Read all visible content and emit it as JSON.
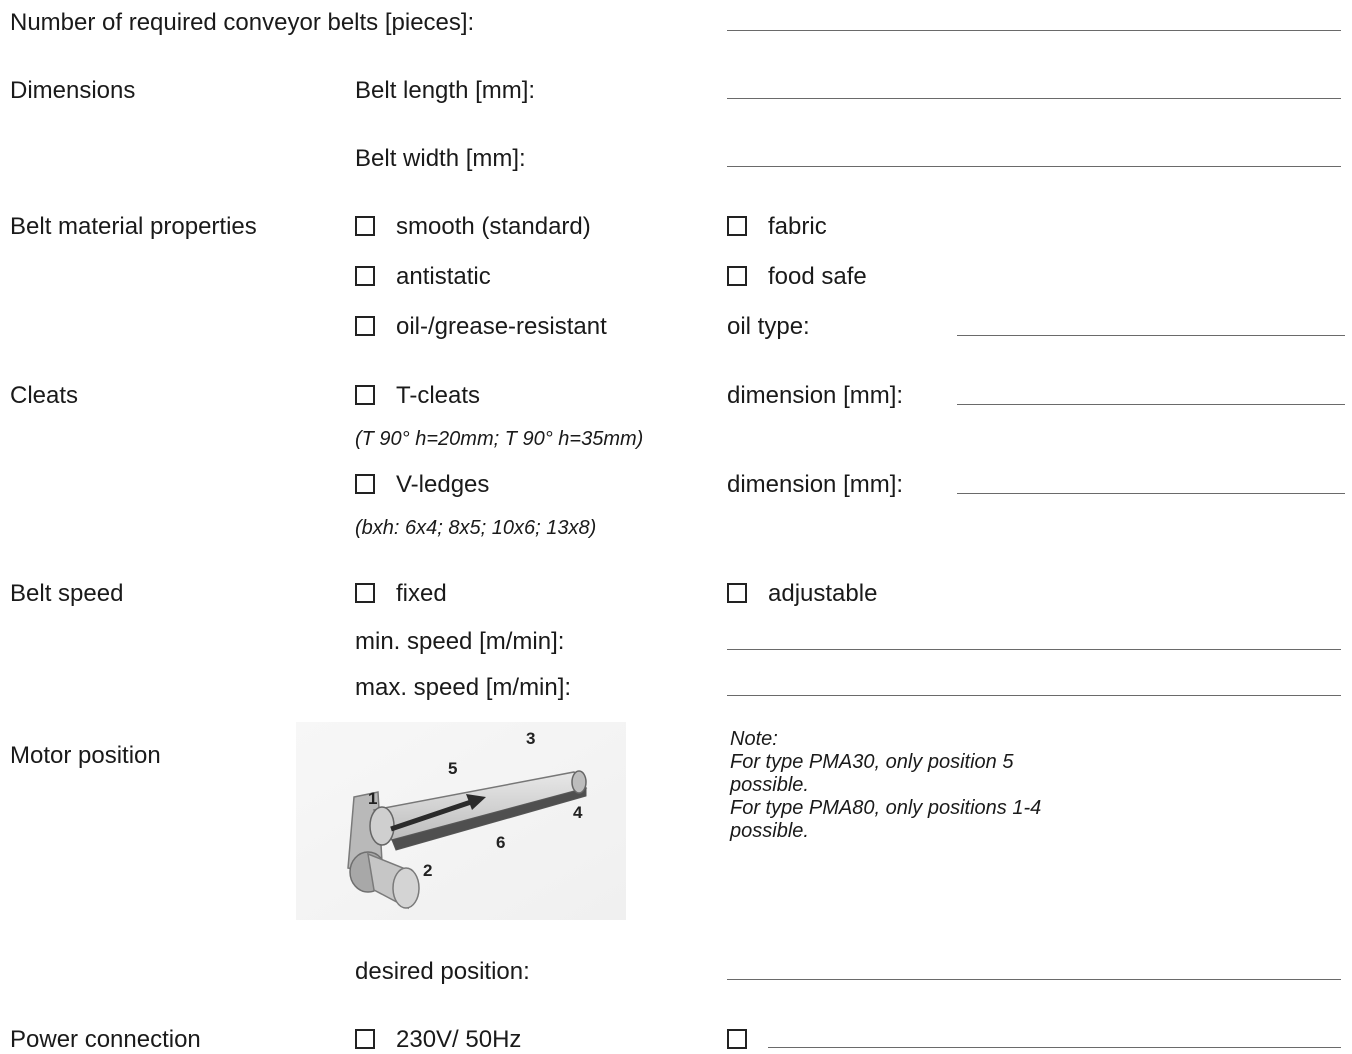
{
  "rows": {
    "count_label": "Number of required conveyor belts [pieces]:",
    "dimensions": {
      "label": "Dimensions",
      "length": "Belt length [mm]:",
      "width": "Belt width [mm]:"
    },
    "material": {
      "label": "Belt material properties",
      "opt_smooth": "smooth (standard)",
      "opt_fabric": "fabric",
      "opt_antistatic": "antistatic",
      "opt_food": "food safe",
      "opt_oil": "oil-/grease-resistant",
      "oil_type": "oil type:"
    },
    "cleats": {
      "label": "Cleats",
      "opt_t": "T-cleats",
      "t_note": "(T 90° h=20mm; T 90° h=35mm)",
      "dim1": "dimension [mm]:",
      "opt_v": "V-ledges",
      "v_note": "(bxh: 6x4; 8x5; 10x6; 13x8)",
      "dim2": "dimension [mm]:"
    },
    "speed": {
      "label": "Belt speed",
      "opt_fixed": "fixed",
      "opt_adjustable": "adjustable",
      "min": "min. speed [m/min]:",
      "max": "max. speed [m/min]:"
    },
    "motor": {
      "label": "Motor position",
      "positions": [
        "1",
        "2",
        "3",
        "4",
        "5",
        "6"
      ],
      "note_title": "Note:",
      "note_1": "For type PMA30, only position 5 possible.",
      "note_2": "For type PMA80, only positions 1-4 possible.",
      "desired": "desired position:"
    },
    "power": {
      "label": "Power connection",
      "opt_230": "230V/ 50Hz"
    }
  }
}
